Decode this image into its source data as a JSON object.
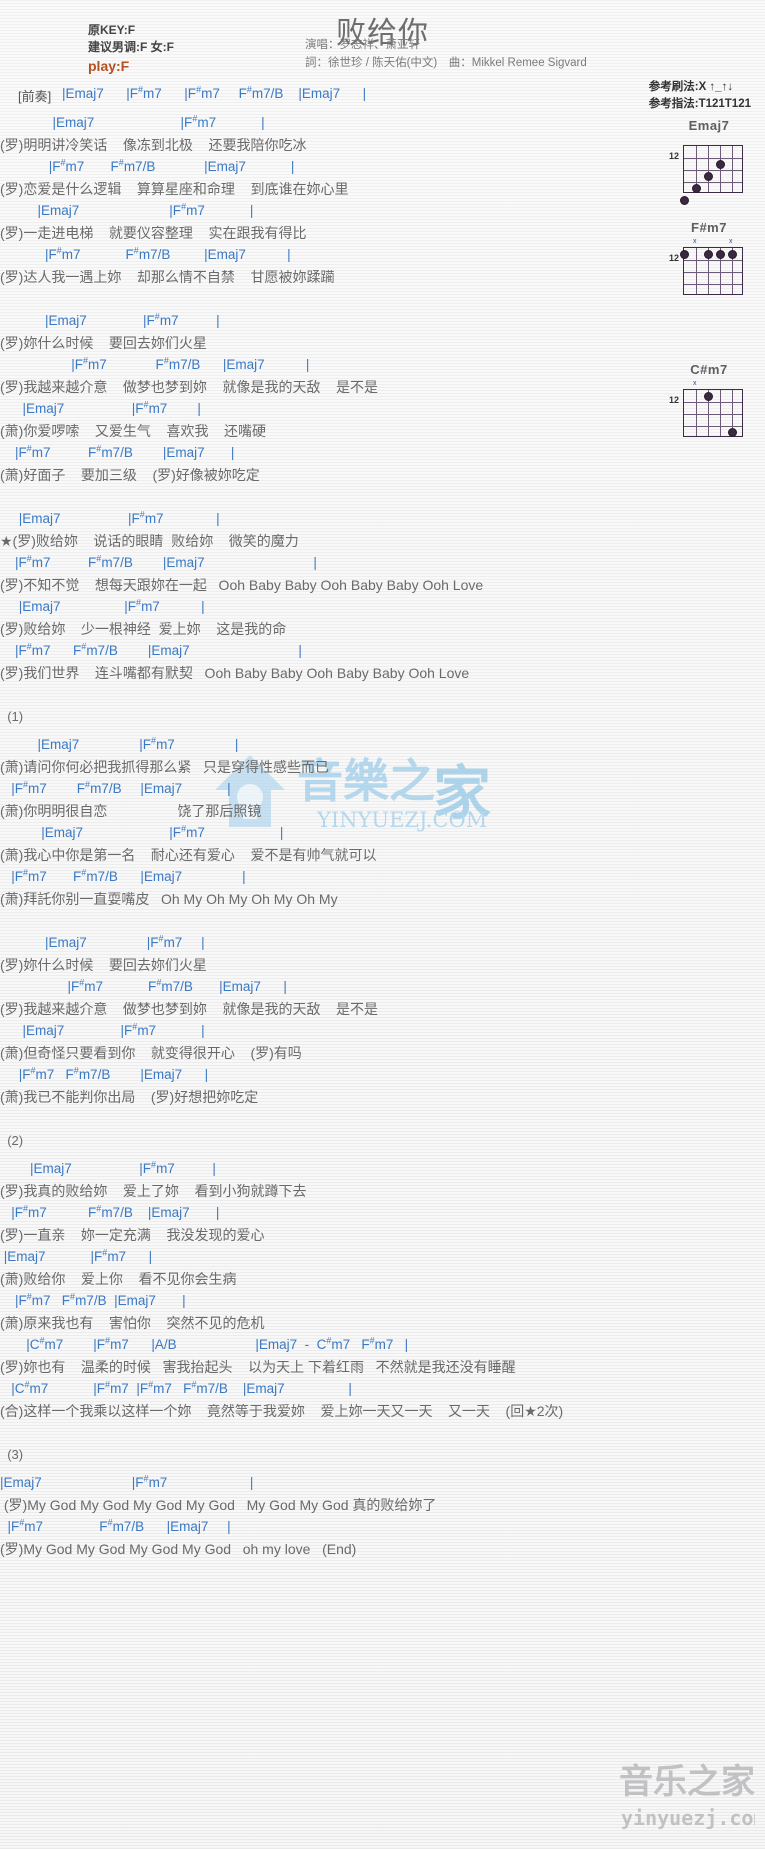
{
  "header": {
    "original_key": "原KEY:F",
    "suggested_key": "建议男调:F 女:F",
    "play_key": "play:F",
    "title": "败给你",
    "singer": "演唱：罗志祥、萧亚轩",
    "writer": "詞：徐世珍 / 陈天佑(中文)　曲：Mikkel Remee Sigvard",
    "strum_ref": "参考刷法:X ↑_↑↓",
    "finger_ref": "参考指法:T121T121",
    "play_color": "#b4501e",
    "chord_color": "#3b79c4"
  },
  "intro": {
    "label": "[前奏]",
    "chords": "|Emaj7      |F#m7      |F#m7     F#m7/B    |Emaj7      |"
  },
  "diagrams": [
    {
      "name": "Emaj7",
      "fret": "12",
      "xmarks": [],
      "dots": [
        [
          4,
          0
        ],
        [
          3,
          1
        ],
        [
          2,
          2
        ],
        [
          1,
          3
        ]
      ]
    },
    {
      "name": "F#m7",
      "fret": "12",
      "xmarks": [
        1,
        4
      ],
      "dots": [
        [
          0,
          0
        ],
        [
          0,
          2
        ],
        [
          0,
          3
        ],
        [
          0,
          4
        ]
      ]
    },
    {
      "name": "C#m7",
      "fret": "12",
      "xmarks": [
        1
      ],
      "dots": [
        [
          0,
          2
        ],
        [
          3,
          4
        ]
      ]
    }
  ],
  "sections": [
    {
      "id": "verse1",
      "lines": [
        {
          "type": "chord",
          "text": "              |Emaj7                       |F#m7            |"
        },
        {
          "type": "lyric",
          "text": "(罗)明明讲冷笑话    像冻到北极    还要我陪你吃冰"
        },
        {
          "type": "chord",
          "text": "             |F#m7       F#m7/B             |Emaj7            |"
        },
        {
          "type": "lyric",
          "text": "(罗)恋爱是什么逻辑    算算星座和命理    到底谁在妳心里"
        },
        {
          "type": "chord",
          "text": "          |Emaj7                        |F#m7            |"
        },
        {
          "type": "lyric",
          "text": "(罗)一走进电梯    就要仪容整理    实在跟我有得比"
        },
        {
          "type": "chord",
          "text": "            |F#m7            F#m7/B         |Emaj7           |"
        },
        {
          "type": "lyric",
          "text": "(罗)达人我一遇上妳    却那么情不自禁    甘愿被妳蹂躏"
        }
      ]
    },
    {
      "id": "verse2",
      "lines": [
        {
          "type": "chord",
          "text": "            |Emaj7               |F#m7          |"
        },
        {
          "type": "lyric",
          "text": "(罗)妳什么时候    要回去妳们火星"
        },
        {
          "type": "chord",
          "text": "                   |F#m7             F#m7/B      |Emaj7           |"
        },
        {
          "type": "lyric",
          "text": "(罗)我越来越介意    做梦也梦到妳    就像是我的天敌    是不是"
        },
        {
          "type": "chord",
          "text": "      |Emaj7                  |F#m7        |"
        },
        {
          "type": "lyric",
          "text": "(萧)你爱啰嗦    又爱生气    喜欢我    还嘴硬"
        },
        {
          "type": "chord",
          "text": "    |F#m7          F#m7/B        |Emaj7       |"
        },
        {
          "type": "lyric",
          "text": "(萧)好面子    要加三级    (罗)好像被妳吃定"
        }
      ]
    },
    {
      "id": "chorus",
      "lines": [
        {
          "type": "chord",
          "text": "     |Emaj7                  |F#m7              |"
        },
        {
          "type": "lyric",
          "text": "★(罗)败给妳    说话的眼睛  败给妳    微笑的魔力"
        },
        {
          "type": "chord",
          "text": "    |F#m7          F#m7/B        |Emaj7                             |"
        },
        {
          "type": "lyric",
          "text": "(罗)不知不觉    想每天跟妳在一起   Ooh Baby Baby Ooh Baby Baby Ooh Love"
        },
        {
          "type": "chord",
          "text": "     |Emaj7                 |F#m7           |"
        },
        {
          "type": "lyric",
          "text": "(罗)败给妳    少一根神经  爱上妳    这是我的命"
        },
        {
          "type": "chord",
          "text": "    |F#m7      F#m7/B        |Emaj7                             |"
        },
        {
          "type": "lyric",
          "text": "(罗)我们世界    连斗嘴都有默契   Ooh Baby Baby Ooh Baby Baby Ooh Love"
        }
      ]
    },
    {
      "id": "part1",
      "marker": "(1)",
      "lines": [
        {
          "type": "chord",
          "text": "          |Emaj7                |F#m7                |"
        },
        {
          "type": "lyric",
          "text": "(萧)请问你何必把我抓得那么紧   只是穿得性感些而已"
        },
        {
          "type": "chord",
          "text": "   |F#m7        F#m7/B     |Emaj7            |"
        },
        {
          "type": "lyric",
          "text": "(萧)你明明很自恋                  饶了那后照镜"
        },
        {
          "type": "chord",
          "text": "           |Emaj7                       |F#m7                    |"
        },
        {
          "type": "lyric",
          "text": "(萧)我心中你是第一名    耐心还有爱心    爱不是有帅气就可以"
        },
        {
          "type": "chord",
          "text": "   |F#m7       F#m7/B      |Emaj7                |"
        },
        {
          "type": "lyric",
          "text": "(萧)拜託你别一直耍嘴皮   Oh My Oh My Oh My Oh My"
        }
      ]
    },
    {
      "id": "part1b",
      "lines": [
        {
          "type": "chord",
          "text": "            |Emaj7                |F#m7     |"
        },
        {
          "type": "lyric",
          "text": "(罗)妳什么时候    要回去妳们火星"
        },
        {
          "type": "chord",
          "text": "                  |F#m7            F#m7/B       |Emaj7      |"
        },
        {
          "type": "lyric",
          "text": "(罗)我越来越介意    做梦也梦到妳    就像是我的天敌    是不是"
        },
        {
          "type": "chord",
          "text": "      |Emaj7               |F#m7            |"
        },
        {
          "type": "lyric",
          "text": "(萧)但奇怪只要看到你    就变得很开心    (罗)有吗"
        },
        {
          "type": "chord",
          "text": "     |F#m7   F#m7/B        |Emaj7      |"
        },
        {
          "type": "lyric",
          "text": "(萧)我已不能判你出局    (罗)好想把妳吃定"
        }
      ]
    },
    {
      "id": "part2",
      "marker": "(2)",
      "lines": [
        {
          "type": "chord",
          "text": "        |Emaj7                  |F#m7          |"
        },
        {
          "type": "lyric",
          "text": "(罗)我真的败给妳    爱上了妳    看到小狗就蹲下去"
        },
        {
          "type": "chord",
          "text": "   |F#m7           F#m7/B    |Emaj7       |"
        },
        {
          "type": "lyric",
          "text": "(罗)一直亲    妳一定充满    我没发现的爱心"
        },
        {
          "type": "chord",
          "text": " |Emaj7            |F#m7      |"
        },
        {
          "type": "lyric",
          "text": "(萧)败给你    爱上你    看不见你会生病"
        },
        {
          "type": "chord",
          "text": "    |F#m7   F#m7/B  |Emaj7       |"
        },
        {
          "type": "lyric",
          "text": "(萧)原来我也有    害怕你    突然不见的危机"
        },
        {
          "type": "chord",
          "text": "       |C#m7        |F#m7      |A/B                     |Emaj7  -  C#m7   F#m7   |"
        },
        {
          "type": "lyric",
          "text": "(罗)妳也有    温柔的时候   害我抬起头    以为天上 下着红雨   不然就是我还没有睡醒"
        },
        {
          "type": "chord",
          "text": "   |C#m7            |F#m7  |F#m7   F#m7/B    |Emaj7                 |"
        },
        {
          "type": "lyric",
          "text": "(合)这样一个我乘以这样一个妳    竟然等于我爱妳    爱上妳一天又一天    又一天    (回★2次)"
        }
      ]
    },
    {
      "id": "part3",
      "marker": "(3)",
      "lines": [
        {
          "type": "chord",
          "text": "|Emaj7                        |F#m7                      |"
        },
        {
          "type": "lyric",
          "text": " (罗)My God My God My God My God   My God My God 真的败给妳了"
        },
        {
          "type": "chord",
          "text": "  |F#m7               F#m7/B      |Emaj7     |"
        },
        {
          "type": "lyric",
          "text": "(罗)My God My God My God My God   oh my love   (End)"
        }
      ]
    }
  ],
  "watermark": {
    "text_cn": "音樂之家",
    "text_en": "YINYUEZJ.COM",
    "footer_cn": "音乐之家",
    "footer_en": "yinyuezj.com"
  }
}
